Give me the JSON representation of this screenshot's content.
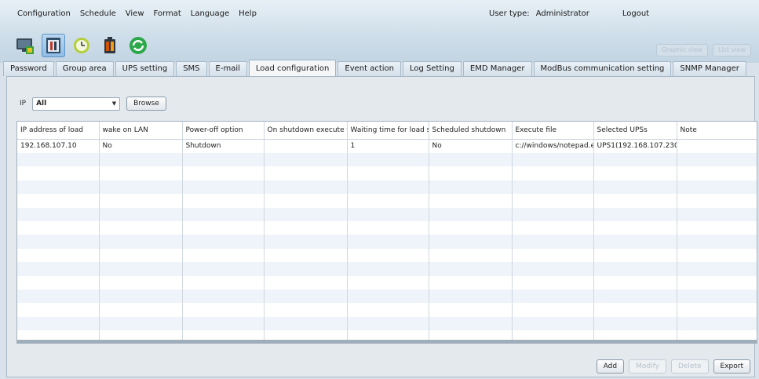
{
  "menu": [
    "Configuration",
    "Schedule",
    "View",
    "Format",
    "Language",
    "Help"
  ],
  "user": {
    "type_label": "User type:",
    "type_value": "Administrator",
    "logout": "Logout"
  },
  "toolbar": {
    "icons": [
      "monitor-icon",
      "config-tools-icon",
      "schedule-clock-icon",
      "battery-icon",
      "refresh-icon"
    ]
  },
  "view_buttons": {
    "graphic": "Graphic view",
    "list": "List view"
  },
  "tabs": [
    "Password",
    "Group area",
    "UPS setting",
    "SMS",
    "E-mail",
    "Load configuration",
    "Event action",
    "Log Setting",
    "EMD Manager",
    "ModBus communication setting",
    "SNMP Manager"
  ],
  "selected_tab": "Load configuration",
  "filter": {
    "label": "IP",
    "value": "All",
    "browse": "Browse"
  },
  "table": {
    "columns": [
      "IP address of load",
      "wake on LAN",
      "Power-off option",
      "On shutdown execute f",
      "Waiting time for load s",
      "Scheduled shutdown",
      "Execute file",
      "Selected UPSs",
      "Note"
    ],
    "rows": [
      [
        "192.168.107.10",
        "No",
        "Shutdown",
        "",
        "1",
        "No",
        "c://windows/notepad.e",
        "UPS1(192.168.107.230",
        ""
      ]
    ]
  },
  "actions": {
    "add": "Add",
    "modify": "Modify",
    "delete": "Delete",
    "export": "Export"
  },
  "colors": {
    "accent": "#8fbce4",
    "panel": "#e4e9ee",
    "row_alt": "#eef4fa"
  }
}
